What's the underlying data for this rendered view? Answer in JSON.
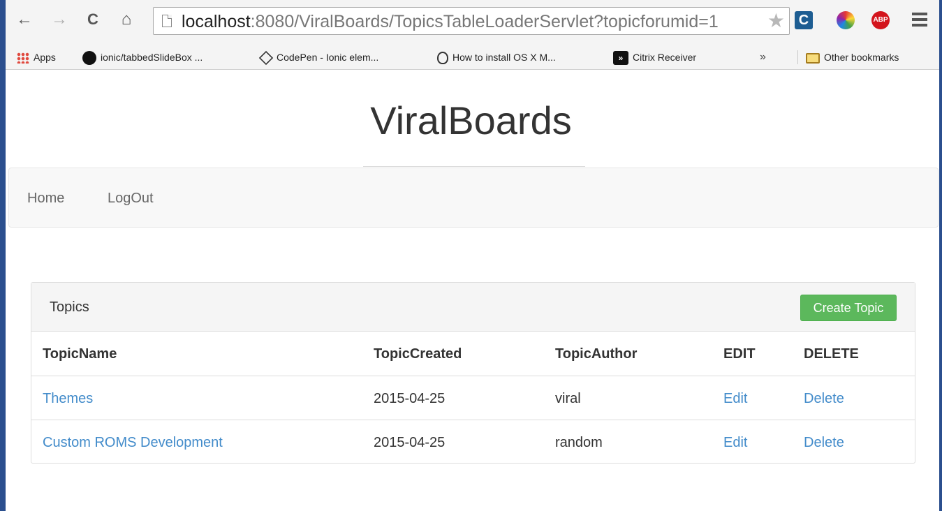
{
  "browser": {
    "nav": {
      "back": "←",
      "forward": "→",
      "reload": "C",
      "home": "⌂"
    },
    "url": {
      "host": "localhost",
      "rest": ":8080/ViralBoards/TopicsTableLoaderServlet?topicforumid=1"
    },
    "star": "★",
    "extensions": {
      "abp_label": "ABP",
      "c_label": "C"
    },
    "bookmarks": [
      {
        "label": "Apps",
        "icon": "apps-grid-icon"
      },
      {
        "label": "ionic/tabbedSlideBox ...",
        "icon": "github-icon"
      },
      {
        "label": "CodePen - Ionic elem...",
        "icon": "codepen-icon"
      },
      {
        "label": "How to install OS X M...",
        "icon": "apple-icon"
      },
      {
        "label": "Citrix Receiver",
        "icon": "citrix-icon"
      }
    ],
    "overflow": "»",
    "other_bookmarks": "Other bookmarks"
  },
  "site": {
    "title": "ViralBoards",
    "nav": {
      "home": "Home",
      "logout": "LogOut"
    }
  },
  "panel": {
    "title": "Topics",
    "create_button": "Create Topic",
    "columns": [
      "TopicName",
      "TopicCreated",
      "TopicAuthor",
      "EDIT",
      "DELETE"
    ],
    "rows": [
      {
        "name": "Themes",
        "created": "2015-04-25",
        "author": "viral",
        "edit": "Edit",
        "delete": "Delete"
      },
      {
        "name": "Custom ROMS Development",
        "created": "2015-04-25",
        "author": "random",
        "edit": "Edit",
        "delete": "Delete"
      }
    ]
  }
}
